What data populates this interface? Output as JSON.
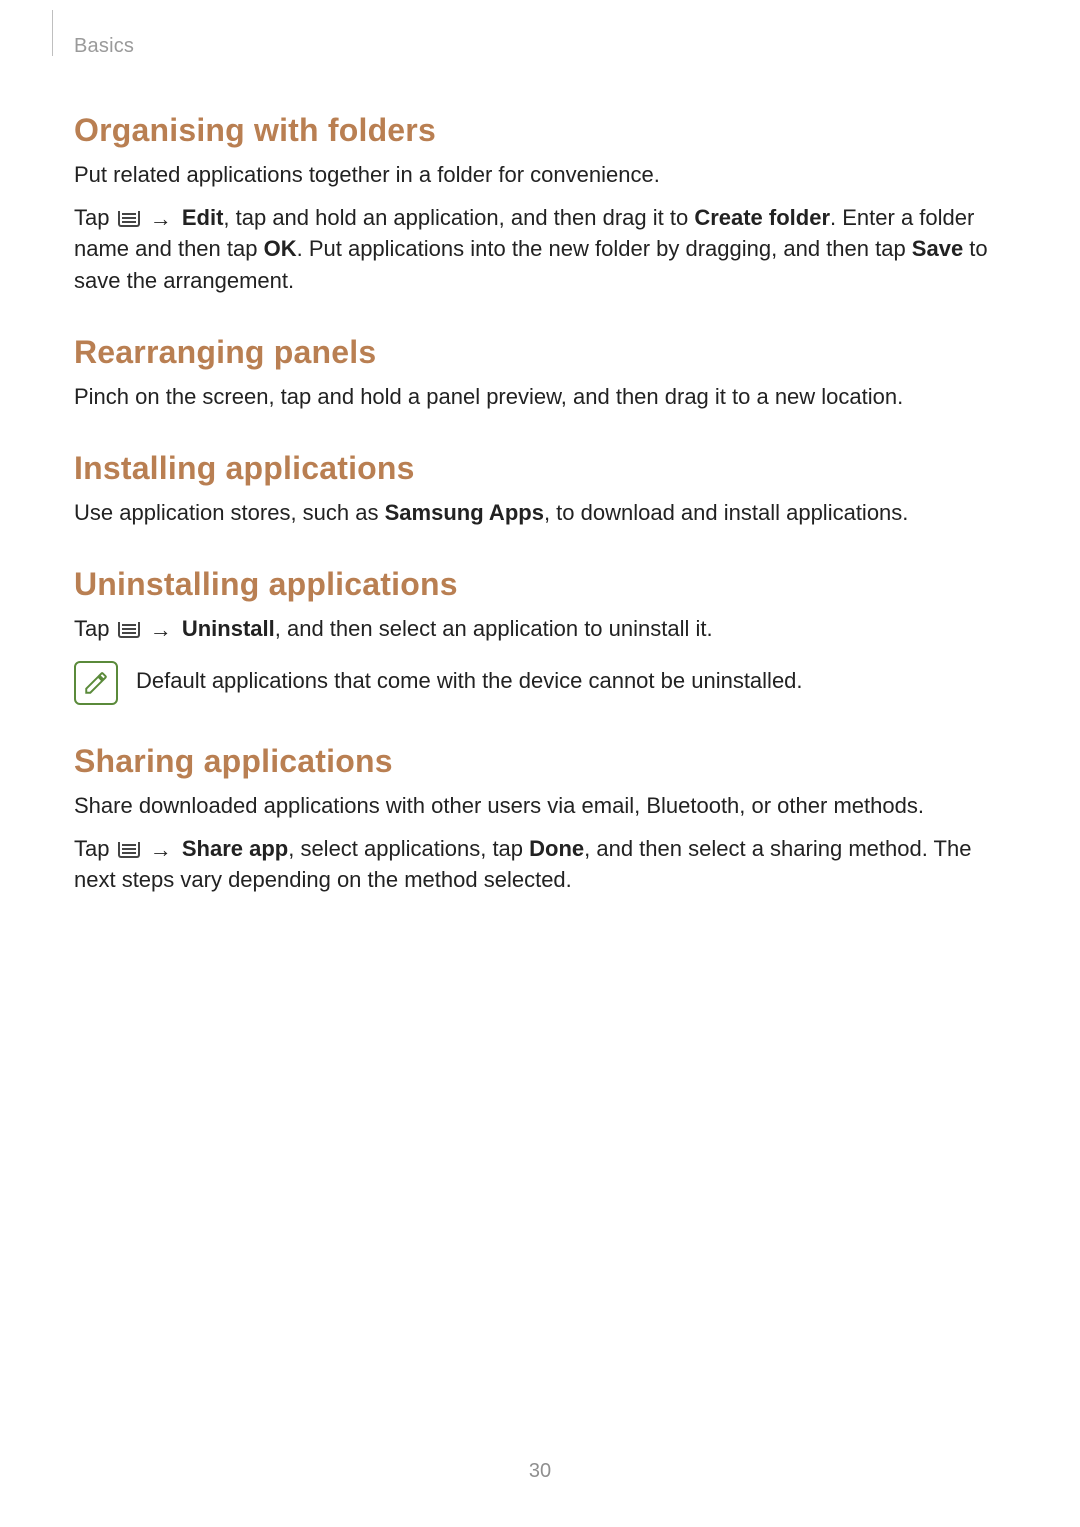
{
  "header": {
    "section_label": "Basics"
  },
  "page_number": "30",
  "colors": {
    "heading": "#b97f52",
    "note_border": "#5a8a3a"
  },
  "sections": {
    "organising": {
      "heading": "Organising with folders",
      "intro": "Put related applications together in a folder for convenience.",
      "instr": {
        "tap": "Tap ",
        "arrow": "→",
        "edit": "Edit",
        "part1": ", tap and hold an application, and then drag it to ",
        "create_folder": "Create folder",
        "part2": ". Enter a folder name and then tap ",
        "ok": "OK",
        "part3": ". Put applications into the new folder by dragging, and then tap ",
        "save": "Save",
        "part4": " to save the arrangement."
      }
    },
    "rearranging": {
      "heading": "Rearranging panels",
      "body": "Pinch on the screen, tap and hold a panel preview, and then drag it to a new location."
    },
    "installing": {
      "heading": "Installing applications",
      "instr": {
        "part1": "Use application stores, such as ",
        "samsung_apps": "Samsung Apps",
        "part2": ", to download and install applications."
      }
    },
    "uninstalling": {
      "heading": "Uninstalling applications",
      "instr": {
        "tap": "Tap ",
        "arrow": "→",
        "uninstall": "Uninstall",
        "part1": ", and then select an application to uninstall it."
      },
      "note": "Default applications that come with the device cannot be uninstalled."
    },
    "sharing": {
      "heading": "Sharing applications",
      "intro": "Share downloaded applications with other users via email, Bluetooth, or other methods.",
      "instr": {
        "tap": "Tap ",
        "arrow": "→",
        "share_app": "Share app",
        "part1": ", select applications, tap ",
        "done": "Done",
        "part2": ", and then select a sharing method. The next steps vary depending on the method selected."
      }
    }
  }
}
